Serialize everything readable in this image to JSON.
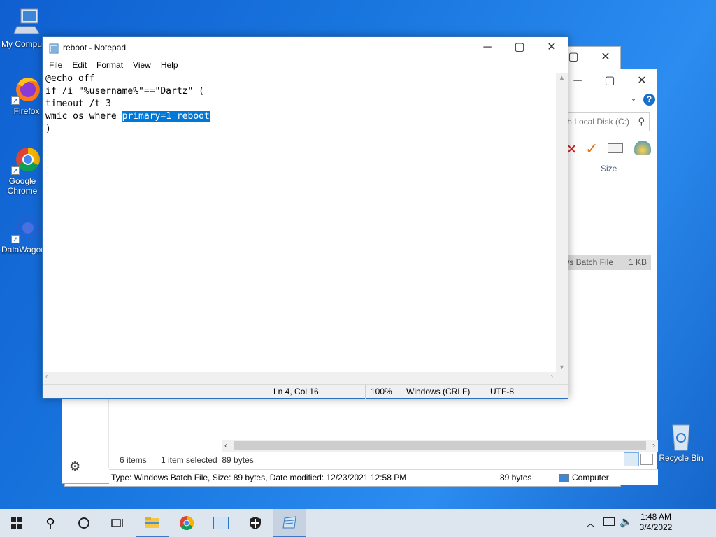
{
  "desktop": {
    "icons": [
      {
        "label": "My Computer"
      },
      {
        "label": "Firefox"
      },
      {
        "label": "Google Chrome"
      },
      {
        "label": "DataWagon"
      },
      {
        "label": "Recycle Bin"
      }
    ]
  },
  "explorer": {
    "search_placeholder": "Search Local Disk (C:)",
    "column_size": "Size",
    "file_type": "Windows Batch File",
    "file_size": "1 KB",
    "status_items": "6 items",
    "status_selected": "1 item selected  89 bytes",
    "details_text": "Type: Windows Batch File, Size: 89 bytes, Date modified: 12/23/2021 12:58 PM",
    "details_size": "89 bytes",
    "details_location": "Computer"
  },
  "notepad": {
    "title": "reboot - Notepad",
    "menu": [
      "File",
      "Edit",
      "Format",
      "View",
      "Help"
    ],
    "lines": {
      "l1": "@echo off",
      "l2": "if /i \"%username%\"==\"Dartz\" (",
      "l3": "timeout /t 3",
      "l4_prefix": "wmic os where ",
      "l4_selected": "primary=1 reboot",
      "l5": ")"
    },
    "status": {
      "position": "Ln 4, Col 16",
      "zoom": "100%",
      "line_endings": "Windows (CRLF)",
      "encoding": "UTF-8"
    }
  },
  "taskbar": {
    "time": "1:48 AM",
    "date": "3/4/2022"
  }
}
